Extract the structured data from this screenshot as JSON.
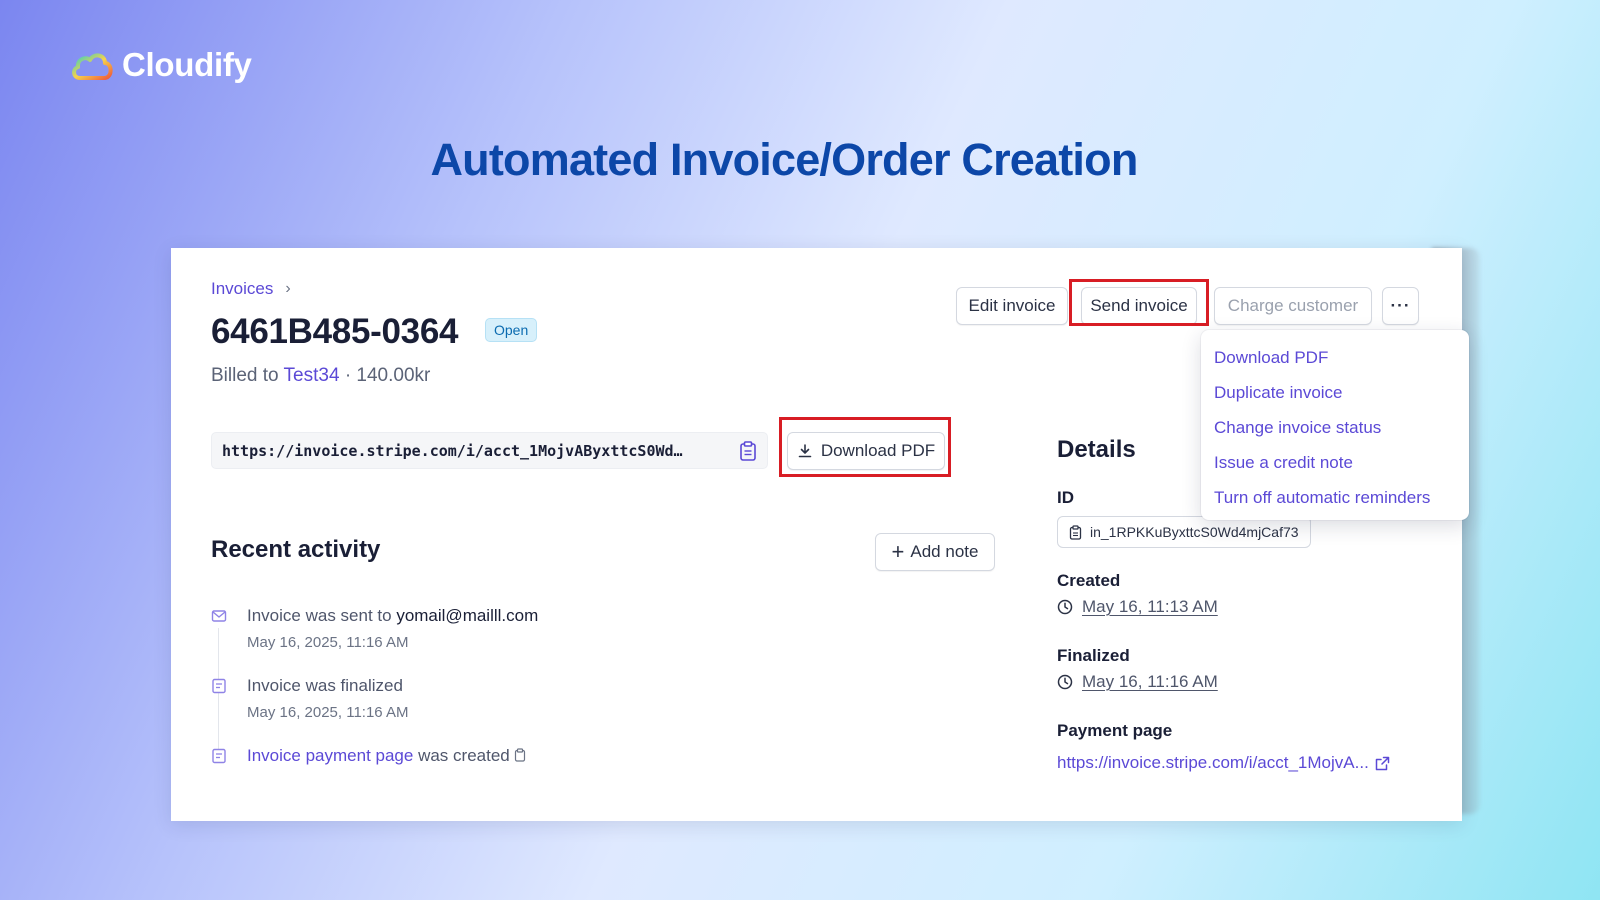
{
  "brand": {
    "name": "Cloudify"
  },
  "headline": "Automated Invoice/Order Creation",
  "invoice": {
    "breadcrumb": "Invoices",
    "number": "6461B485-0364",
    "status": "Open",
    "billed_prefix": "Billed to",
    "customer": "Test34",
    "amount": "· 140.00kr",
    "url": "https://invoice.stripe.com/i/acct_1MojvAByxttcS0Wd…"
  },
  "toolbar": {
    "edit": "Edit invoice",
    "send": "Send invoice",
    "charge": "Charge customer",
    "more": "···"
  },
  "dropdown": {
    "items": [
      "Download PDF",
      "Duplicate invoice",
      "Change invoice status",
      "Issue a credit note",
      "Turn off automatic reminders"
    ]
  },
  "download_pdf": "Download PDF",
  "activity": {
    "title": "Recent activity",
    "add_note": "Add note",
    "items": [
      {
        "prefix": "Invoice was sent to",
        "highlight": "yomail@mailll.com",
        "time": "May 16, 2025, 11:16 AM"
      },
      {
        "text": "Invoice was finalized",
        "time": "May 16, 2025, 11:16 AM"
      },
      {
        "link": "Invoice payment page",
        "suffix": "was created"
      }
    ]
  },
  "details": {
    "title": "Details",
    "id_label": "ID",
    "id_value": "in_1RPKKuByxttcS0Wd4mjCaf73",
    "created_label": "Created",
    "created_value": "May 16, 11:13 AM",
    "finalized_label": "Finalized",
    "finalized_value": "May 16, 11:16 AM",
    "payment_label": "Payment page",
    "payment_value": "https://invoice.stripe.com/i/acct_1MojvA..."
  },
  "colors": {
    "accent": "#5b49d6",
    "headline": "#0c47a8",
    "highlight_box": "#d81d24"
  }
}
